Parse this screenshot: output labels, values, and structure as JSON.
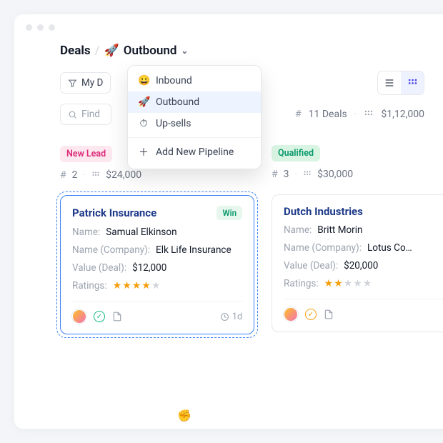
{
  "breadcrumb": {
    "root": "Deals",
    "current": "Outbound",
    "icon": "🚀"
  },
  "dropdown": {
    "items": [
      {
        "icon": "😀",
        "label": "Inbound"
      },
      {
        "icon": "🚀",
        "label": "Outbound"
      },
      {
        "icon": "⏱",
        "label": "Up-sells"
      }
    ],
    "add_label": "Add New Pipeline"
  },
  "filter": {
    "my_deals_label": "My D"
  },
  "search": {
    "placeholder": "Find"
  },
  "summary": {
    "count_label": "11 Deals",
    "total_label": "$1,12,000"
  },
  "columns": [
    {
      "name": "New Lead",
      "badge_class": "badge-pink",
      "count": "2",
      "value": "$24,000",
      "cards": [
        {
          "title": "Patrick Insurance",
          "status": "Win",
          "fields": {
            "name_label": "Name:",
            "name_val": "Samual Elkinson",
            "company_label": "Name (Company):",
            "company_val": "Elk Life Insurance",
            "value_label": "Value (Deal):",
            "value_val": "$12,000",
            "ratings_label": "Ratings:"
          },
          "rating_full": "★★★★",
          "rating_empty": "★",
          "foot": {
            "status_icon": "ok",
            "time": "1d"
          }
        }
      ]
    },
    {
      "name": "Qualified",
      "badge_class": "badge-green",
      "count": "3",
      "value": "$30,000",
      "cards": [
        {
          "title": "Dutch Industries",
          "fields": {
            "name_label": "Name:",
            "name_val": "Britt Morin",
            "company_label": "Name (Company):",
            "company_val": "Lotus Co…",
            "value_label": "Value (Deal):",
            "value_val": "$20,000",
            "ratings_label": "Ratings:"
          },
          "rating_full": "★★",
          "rating_empty": "★★★",
          "foot": {
            "status_icon": "warn"
          }
        }
      ]
    }
  ]
}
